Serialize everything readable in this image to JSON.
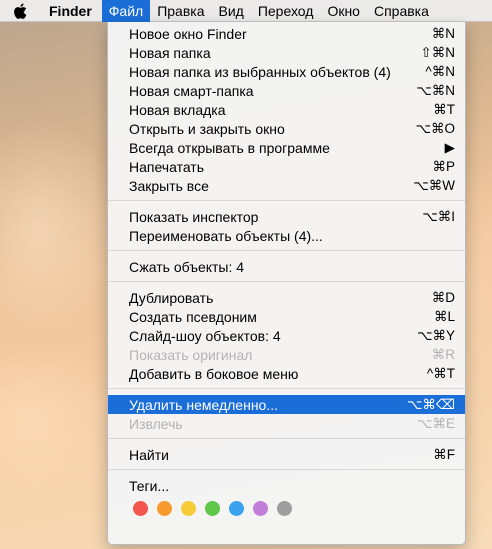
{
  "menubar": {
    "apple_icon": "apple-logo-icon",
    "items": [
      {
        "label": "Finder"
      },
      {
        "label": "Файл"
      },
      {
        "label": "Правка"
      },
      {
        "label": "Вид"
      },
      {
        "label": "Переход"
      },
      {
        "label": "Окно"
      },
      {
        "label": "Справка"
      }
    ]
  },
  "file_menu": {
    "items": [
      {
        "label": "Новое окно Finder",
        "shortcut": "⌘N"
      },
      {
        "label": "Новая папка",
        "shortcut": "⇧⌘N"
      },
      {
        "label": "Новая папка из выбранных объектов (4)",
        "shortcut": "^⌘N"
      },
      {
        "label": "Новая смарт-папка",
        "shortcut": "⌥⌘N"
      },
      {
        "label": "Новая вкладка",
        "shortcut": "⌘T"
      },
      {
        "label": "Открыть и закрыть окно",
        "shortcut": "⌥⌘O"
      },
      {
        "label": "Всегда открывать в программе",
        "shortcut": "▶"
      },
      {
        "label": "Напечатать",
        "shortcut": "⌘P"
      },
      {
        "label": "Закрыть все",
        "shortcut": "⌥⌘W"
      },
      {
        "label": "Показать инспектор",
        "shortcut": "⌥⌘I"
      },
      {
        "label": "Переименовать объекты (4)...",
        "shortcut": ""
      },
      {
        "label": "Сжать объекты: 4",
        "shortcut": ""
      },
      {
        "label": "Дублировать",
        "shortcut": "⌘D"
      },
      {
        "label": "Создать псевдоним",
        "shortcut": "⌘L"
      },
      {
        "label": "Слайд-шоу объектов: 4",
        "shortcut": "⌥⌘Y"
      },
      {
        "label": "Показать оригинал",
        "shortcut": "⌘R",
        "disabled": true
      },
      {
        "label": "Добавить в боковое меню",
        "shortcut": "^⌘T"
      },
      {
        "label": "Удалить немедленно...",
        "shortcut": "⌥⌘⌫",
        "highlighted": true
      },
      {
        "label": "Извлечь",
        "shortcut": "⌥⌘E",
        "disabled": true
      },
      {
        "label": "Найти",
        "shortcut": "⌘F"
      },
      {
        "label": "Теги...",
        "shortcut": ""
      }
    ],
    "tag_colors": [
      {
        "name": "red",
        "hex": "#f4564e"
      },
      {
        "name": "orange",
        "hex": "#f79b2e"
      },
      {
        "name": "yellow",
        "hex": "#f6cc38"
      },
      {
        "name": "green",
        "hex": "#5fc74a"
      },
      {
        "name": "blue",
        "hex": "#3aa3f0"
      },
      {
        "name": "purple",
        "hex": "#c27ed9"
      },
      {
        "name": "gray",
        "hex": "#9e9e9e"
      }
    ]
  }
}
